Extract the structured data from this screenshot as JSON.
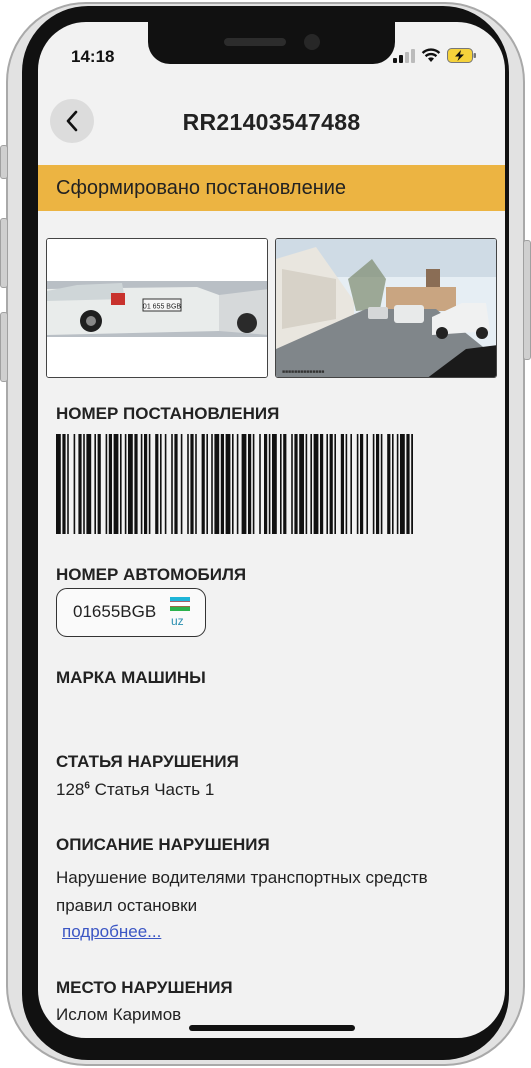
{
  "status_bar": {
    "time": "14:18",
    "icons": [
      "signal-icon",
      "wifi-icon",
      "battery-charging-icon"
    ]
  },
  "header": {
    "back_icon": "chevron-left-icon",
    "title": "RR21403547488"
  },
  "banner": {
    "text": "Сформировано постановление",
    "color": "#ecb442"
  },
  "photos": [
    {
      "name": "violation-photo-plate-closeup"
    },
    {
      "name": "violation-photo-street-view"
    }
  ],
  "ruling_number": {
    "label": "НОМЕР ПОСТАНОВЛЕНИЯ"
  },
  "vehicle_number": {
    "label": "НОМЕР АВТОМОБИЛЯ",
    "plate": "01655BGB",
    "country_code": "uz"
  },
  "car_brand": {
    "label": "МАРКА МАШИНЫ",
    "value": ""
  },
  "violation_article": {
    "label": "СТАТЬЯ НАРУШЕНИЯ",
    "number": "128",
    "superscript": "6",
    "text": "Статья  Часть 1"
  },
  "violation_description": {
    "label": "ОПИСАНИЕ НАРУШЕНИЯ",
    "line1": "Нарушение водителями транспортных средств",
    "line2": "правил остановки",
    "more_link": "подробнее..."
  },
  "violation_place": {
    "label": "МЕСТО НАРУШЕНИЯ",
    "value": "Ислом Каримов"
  }
}
